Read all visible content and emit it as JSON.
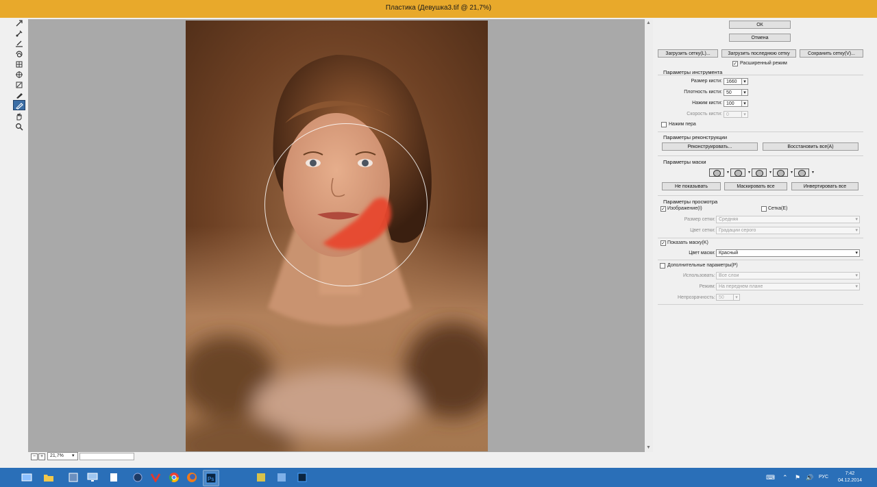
{
  "window": {
    "title": "Пластика (Девушка3.tif @ 21,7%)"
  },
  "status": {
    "zoom": "21,7%"
  },
  "buttons": {
    "ok": "ОК",
    "cancel": "Отмена",
    "load_mesh": "Загрузить сетку(L)...",
    "load_last_mesh": "Загрузить последнюю сетку",
    "save_mesh": "Сохранить сетку(V)...",
    "reconstruct": "Реконструировать...",
    "restore_all": "Восстановить все(A)",
    "none": "Не показывать",
    "mask_all": "Маскировать все",
    "invert_all": "Инвертировать все"
  },
  "advanced_mode": {
    "label": "Расширенный режим",
    "checked": true
  },
  "tool_options": {
    "heading": "Параметры инструмента",
    "brush_size_label": "Размер кисти:",
    "brush_size": "1660",
    "brush_density_label": "Плотность кисти:",
    "brush_density": "50",
    "brush_pressure_label": "Нажим кисти:",
    "brush_pressure": "100",
    "brush_rate_label": "Скорость кисти:",
    "brush_rate": "0",
    "stylus_pressure_label": "Нажим пера"
  },
  "reconstruct_options": {
    "heading": "Параметры реконструкции"
  },
  "mask_options": {
    "heading": "Параметры маски"
  },
  "view_options": {
    "heading": "Параметры просмотра",
    "image_label": "Изображение(I)",
    "mesh_label": "Сетка(E)",
    "mesh_size_label": "Размер сетки:",
    "mesh_size": "Средняя",
    "mesh_color_label": "Цвет сетки:",
    "mesh_color": "Градации серого",
    "show_mask_label": "Показать маску(K)",
    "mask_color_label": "Цвет маски:",
    "mask_color": "Красный"
  },
  "backdrop": {
    "label": "Дополнительные параметры(P)",
    "use_label": "Использовать:",
    "use": "Все слои",
    "mode_label": "Режим:",
    "mode": "На переднем плане",
    "opacity_label": "Непрозрачность:",
    "opacity": "50"
  },
  "taskbar": {
    "lang": "РУС",
    "time": "7:42",
    "date": "04.12.2014"
  },
  "colors": {
    "title_bar": "#e8a92b",
    "taskbar": "#2a6fb8",
    "mask": "#e8452b"
  },
  "icons": [
    "forward-warp-tool-icon",
    "reconstruct-tool-icon",
    "smooth-tool-icon",
    "twirl-clockwise-tool-icon",
    "pucker-tool-icon",
    "bloat-tool-icon",
    "push-left-tool-icon",
    "freeze-mask-tool-icon",
    "thaw-mask-tool-icon",
    "hand-tool-icon",
    "zoom-tool-icon"
  ]
}
